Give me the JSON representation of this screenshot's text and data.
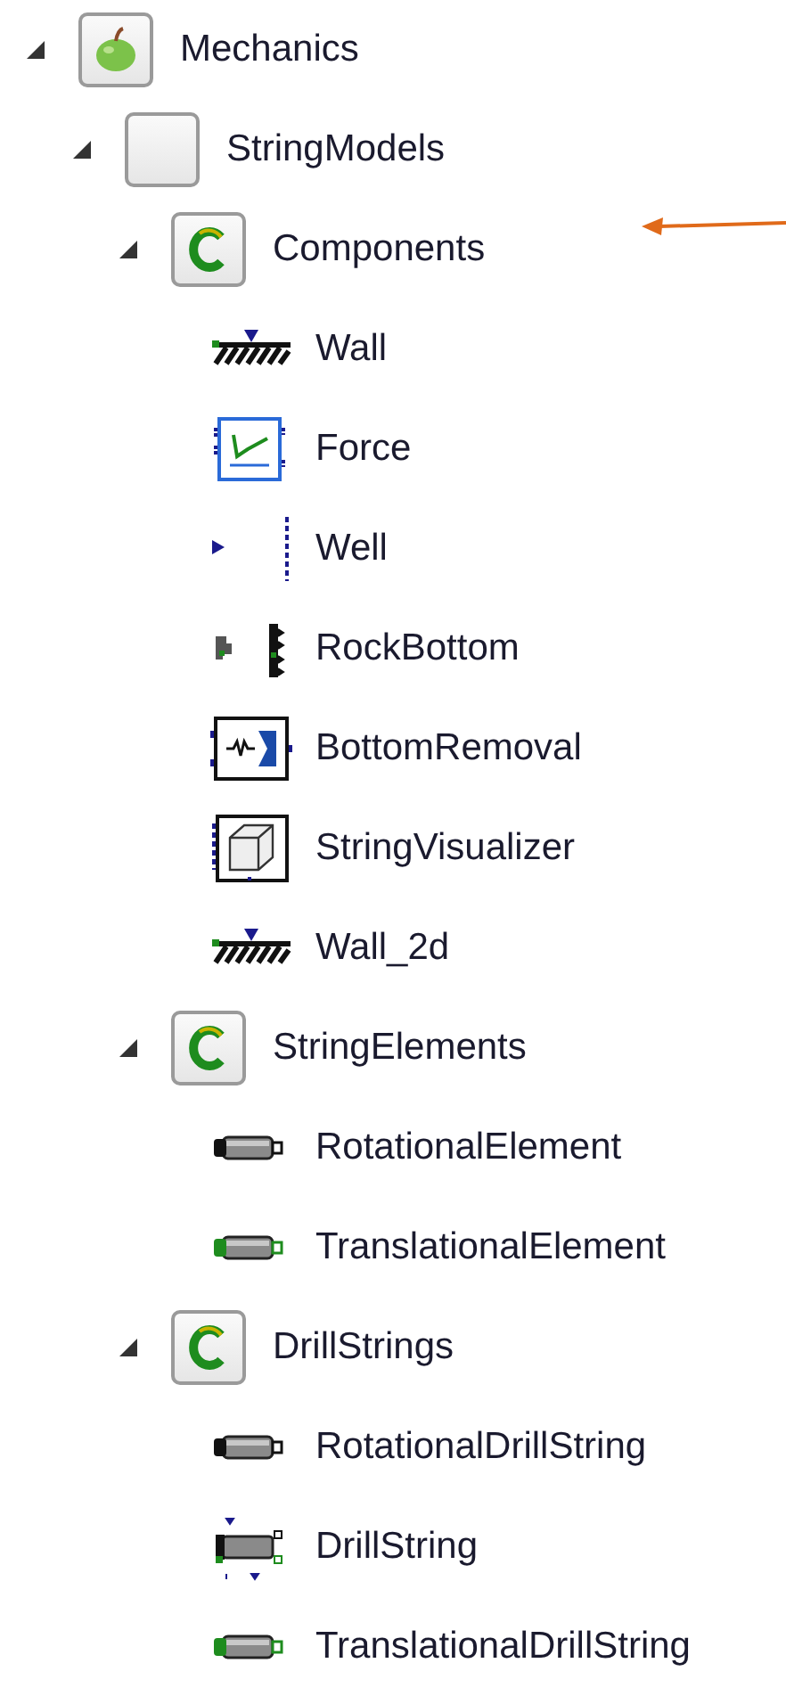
{
  "tree": [
    {
      "label": "Mechanics",
      "kind": "package-apple",
      "expanded": true,
      "pointed": false,
      "children": [
        {
          "label": "StringModels",
          "kind": "package-blank",
          "expanded": true,
          "pointed": false,
          "children": [
            {
              "label": "Components",
              "kind": "class",
              "expanded": true,
              "pointed": true,
              "children": [
                {
                  "label": "Wall",
                  "kind": "wall"
                },
                {
                  "label": "Force",
                  "kind": "force"
                },
                {
                  "label": "Well",
                  "kind": "well"
                },
                {
                  "label": "RockBottom",
                  "kind": "rock"
                },
                {
                  "label": "BottomRemoval",
                  "kind": "removal"
                },
                {
                  "label": "StringVisualizer",
                  "kind": "visualizer"
                },
                {
                  "label": "Wall_2d",
                  "kind": "wall"
                }
              ]
            },
            {
              "label": "StringElements",
              "kind": "class",
              "expanded": true,
              "pointed": false,
              "children": [
                {
                  "label": "RotationalElement",
                  "kind": "rotational"
                },
                {
                  "label": "TranslationalElement",
                  "kind": "translational"
                }
              ]
            },
            {
              "label": "DrillStrings",
              "kind": "class",
              "expanded": true,
              "pointed": false,
              "children": [
                {
                  "label": "RotationalDrillString",
                  "kind": "rotational"
                },
                {
                  "label": "DrillString",
                  "kind": "drill"
                },
                {
                  "label": "TranslationalDrillString",
                  "kind": "translational"
                }
              ]
            }
          ]
        }
      ]
    }
  ]
}
